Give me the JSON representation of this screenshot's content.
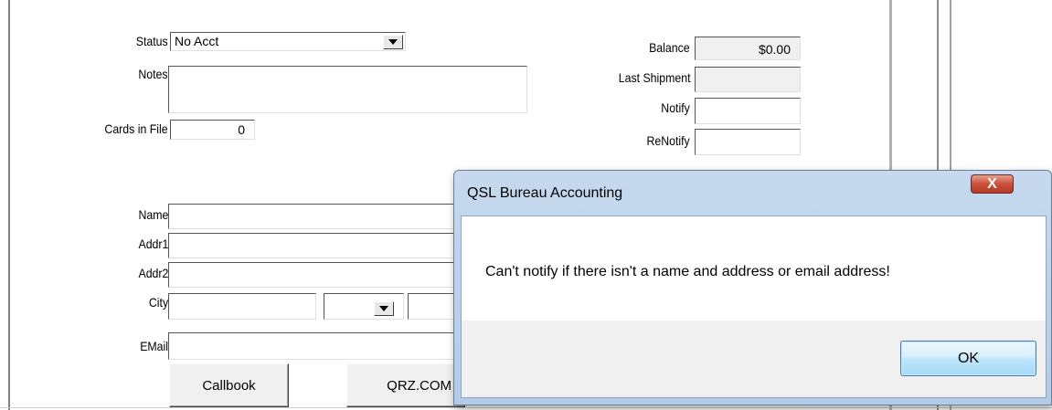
{
  "form": {
    "status_label": "Status",
    "status_value": "No Acct",
    "notes_label": "Notes",
    "notes_value": "",
    "cards_label": "Cards in File",
    "cards_value": "0",
    "balance_label": "Balance",
    "balance_value": "$0.00",
    "last_shipment_label": "Last Shipment",
    "last_shipment_value": "",
    "notify_label": "Notify",
    "notify_value": "",
    "renotify_label": "ReNotify",
    "renotify_value": "",
    "name_label": "Name",
    "addr1_label": "Addr1",
    "addr2_label": "Addr2",
    "city_label": "City",
    "email_label": "EMail",
    "callbook_button": "Callbook",
    "qrz_button": "QRZ.COM"
  },
  "dialog": {
    "title": "QSL Bureau Accounting",
    "close_glyph": "X",
    "message": "Can't notify if there isn't a name and address or email address!",
    "ok_label": "OK"
  }
}
